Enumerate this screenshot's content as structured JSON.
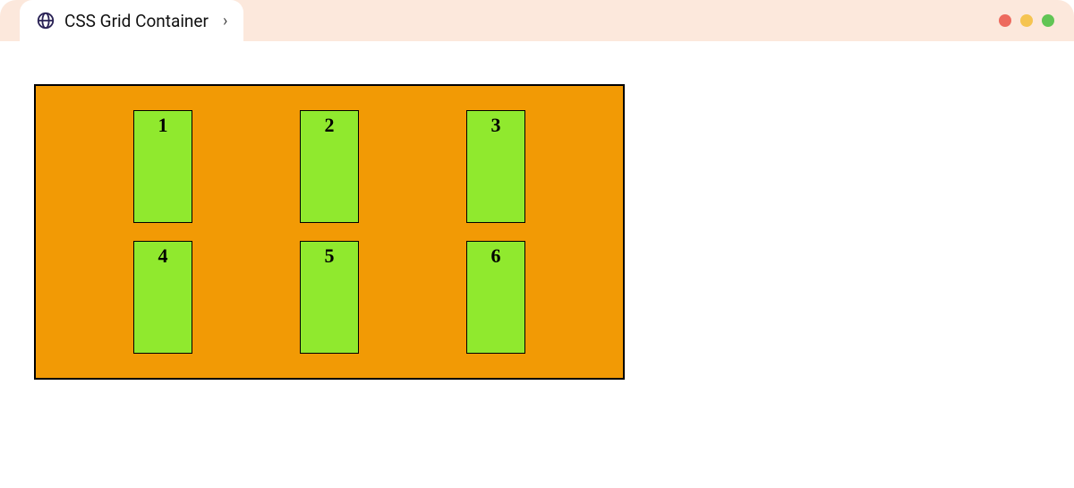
{
  "tab": {
    "title": "CSS Grid Container",
    "icon": "globe-icon",
    "chevron": "›"
  },
  "traffic_lights": {
    "red": "#ed6a5e",
    "yellow": "#f5c451",
    "green": "#61c555"
  },
  "grid": {
    "container_bg": "#f29a05",
    "cell_bg": "#90e92e",
    "items": [
      "1",
      "2",
      "3",
      "4",
      "5",
      "6"
    ]
  }
}
